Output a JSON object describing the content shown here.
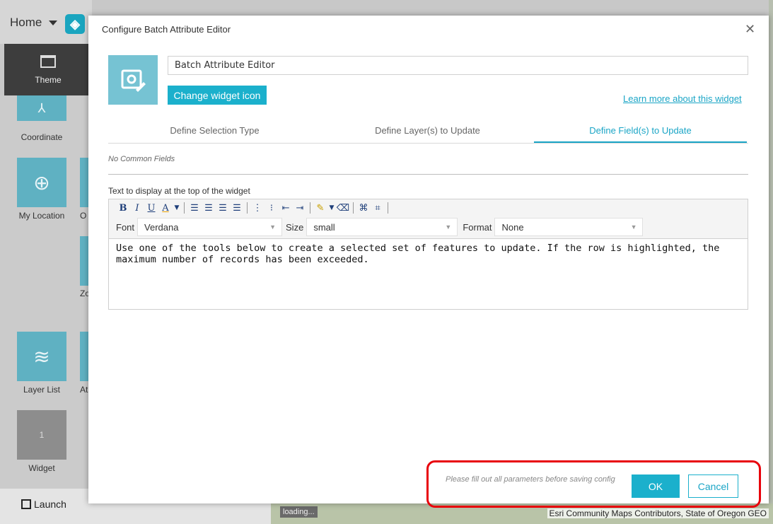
{
  "background": {
    "home_label": "Home",
    "theme_tab": "Theme",
    "widgets": [
      {
        "label": "Coordinate"
      },
      {
        "label": "My Location"
      },
      {
        "label": "Layer List"
      },
      {
        "label": "Widget",
        "placeholder_number": "1"
      }
    ],
    "partial_labels": [
      "O",
      "Zo",
      "At"
    ],
    "launch_label": "Launch",
    "loading_text": "loading...",
    "map_attribution": "Esri Community Maps Contributors, State of Oregon GEO"
  },
  "dialog": {
    "title": "Configure Batch Attribute Editor",
    "close_icon": "close-icon",
    "widget_name_value": "Batch Attribute Editor",
    "change_icon_label": "Change widget icon",
    "learn_more_label": "Learn more about this widget",
    "tabs": [
      {
        "label": "Define Selection Type",
        "active": false
      },
      {
        "label": "Define Layer(s) to Update",
        "active": false
      },
      {
        "label": "Define Field(s) to Update",
        "active": true
      }
    ],
    "no_common_fields": "No Common Fields",
    "editor": {
      "label": "Text to display at the top of the widget",
      "toolbar": {
        "bold": "B",
        "italic": "I",
        "underline": "U",
        "font_color": "A",
        "font_label": "Font",
        "font_value": "Verdana",
        "size_label": "Size",
        "size_value": "small",
        "format_label": "Format",
        "format_value": "None"
      },
      "content": "Use one of the tools below to create a selected set of features to update. If the row is highlighted, the maximum number of records has been exceeded."
    },
    "footer_note": "Please fill out all parameters before saving config",
    "ok_label": "OK",
    "cancel_label": "Cancel"
  },
  "colors": {
    "accent": "#1bb0cc",
    "highlight": "#e8000b"
  }
}
